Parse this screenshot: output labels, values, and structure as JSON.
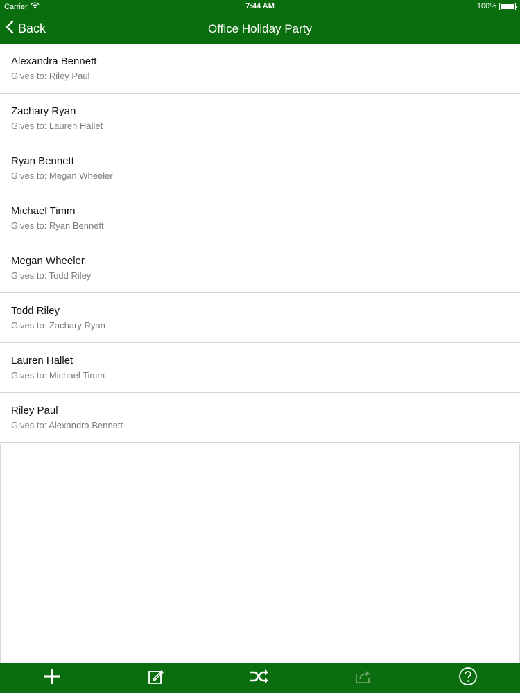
{
  "status": {
    "carrier": "Carrier",
    "time": "7:44 AM",
    "battery": "100%"
  },
  "nav": {
    "back_label": "Back",
    "title": "Office Holiday Party"
  },
  "participants": [
    {
      "name": "Alexandra Bennett",
      "gives_to": "Gives to: Riley Paul"
    },
    {
      "name": "Zachary Ryan",
      "gives_to": "Gives to: Lauren Hallet"
    },
    {
      "name": "Ryan Bennett",
      "gives_to": "Gives to: Megan Wheeler"
    },
    {
      "name": "Michael Timm",
      "gives_to": "Gives to: Ryan Bennett"
    },
    {
      "name": "Megan Wheeler",
      "gives_to": "Gives to: Todd Riley"
    },
    {
      "name": "Todd Riley",
      "gives_to": "Gives to: Zachary Ryan"
    },
    {
      "name": "Lauren Hallet",
      "gives_to": "Gives to: Michael Timm"
    },
    {
      "name": "Riley Paul",
      "gives_to": "Gives to: Alexandra Bennett"
    }
  ],
  "toolbar": {
    "items": [
      {
        "icon": "plus-icon"
      },
      {
        "icon": "edit-icon"
      },
      {
        "icon": "shuffle-icon"
      },
      {
        "icon": "share-icon"
      },
      {
        "icon": "help-icon"
      }
    ]
  },
  "colors": {
    "accent": "#0b6e0e",
    "disabled_icon": "#6aa46c"
  }
}
